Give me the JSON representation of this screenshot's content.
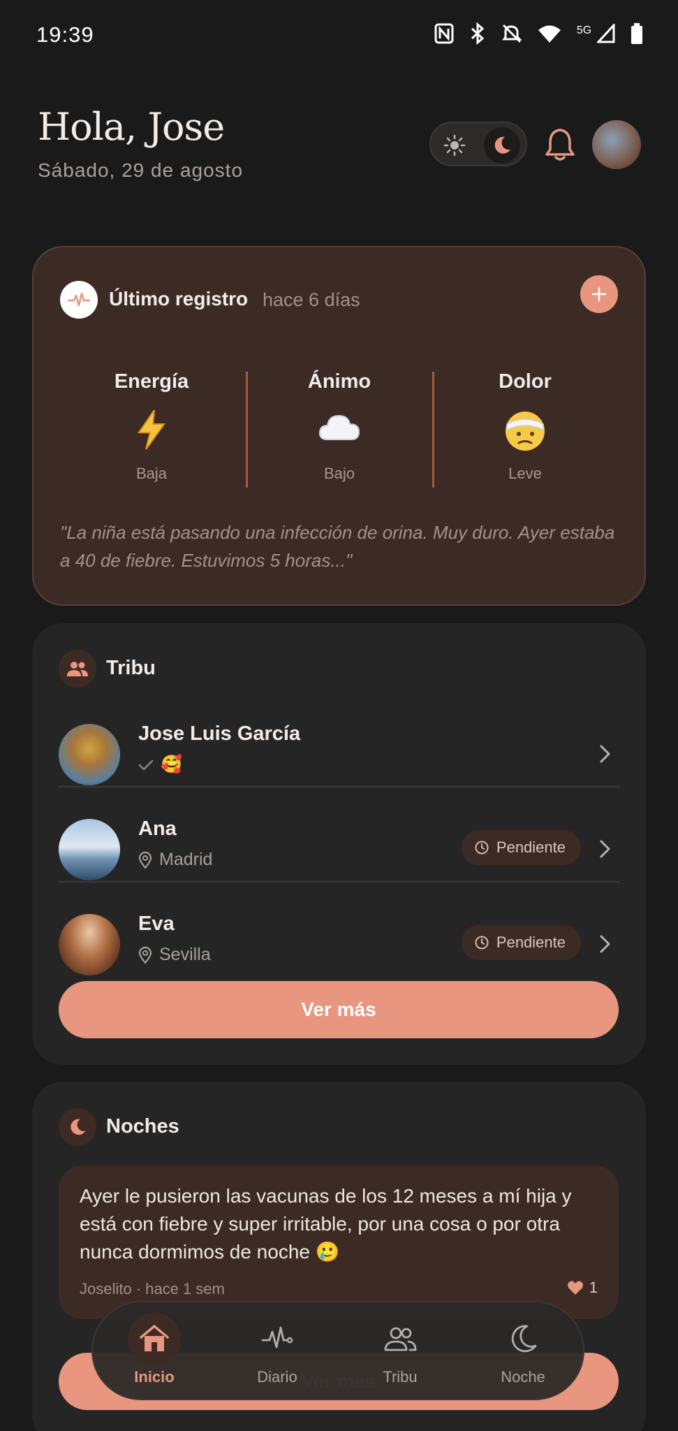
{
  "status_bar": {
    "time": "19:39",
    "network": "5G",
    "icons": [
      "nfc-icon",
      "bluetooth-icon",
      "mute-icon",
      "wifi-icon",
      "signal-icon",
      "battery-icon"
    ]
  },
  "header": {
    "greeting": "Hola, Jose",
    "date": "Sábado, 29 de agosto"
  },
  "registro": {
    "title": "Último registro",
    "time_ago": "hace 6 días",
    "metrics": [
      {
        "title": "Energía",
        "emoji": "⚡",
        "label": "Baja"
      },
      {
        "title": "Ánimo",
        "emoji": "☁️",
        "label": "Bajo"
      },
      {
        "title": "Dolor",
        "emoji": "🤕",
        "label": "Leve"
      }
    ],
    "quote": "\"La niña está pasando una infección de orina. Muy duro. Ayer estaba a 40 de fiebre. Estuvimos 5 horas...\""
  },
  "tribu": {
    "title": "Tribu",
    "people": [
      {
        "name": "Jose Luis García",
        "sub": "🥰",
        "badge": ""
      },
      {
        "name": "Ana",
        "sub": "Madrid",
        "badge": "Pendiente"
      },
      {
        "name": "Eva",
        "sub": "Sevilla",
        "badge": "Pendiente"
      }
    ],
    "button": "Ver más"
  },
  "noches": {
    "title": "Noches",
    "post": {
      "text": "Ayer le pusieron las vacunas de los 12 meses a mí hija y está con fiebre y super irritable, por una cosa o por otra nunca dormimos de noche 🥲",
      "meta": "Joselito · hace 1 sem",
      "likes": "1"
    },
    "button": "Ver más"
  },
  "nav": {
    "items": [
      {
        "label": "Inicio",
        "icon": "home-icon",
        "active": true
      },
      {
        "label": "Diario",
        "icon": "pulse-icon",
        "active": false
      },
      {
        "label": "Tribu",
        "icon": "people-icon",
        "active": false
      },
      {
        "label": "Noche",
        "icon": "moon-icon",
        "active": false
      }
    ]
  },
  "colors": {
    "accent": "#e8967f",
    "background": "#1a1a1a",
    "card": "#262525",
    "card_warm": "#3c2a25"
  }
}
